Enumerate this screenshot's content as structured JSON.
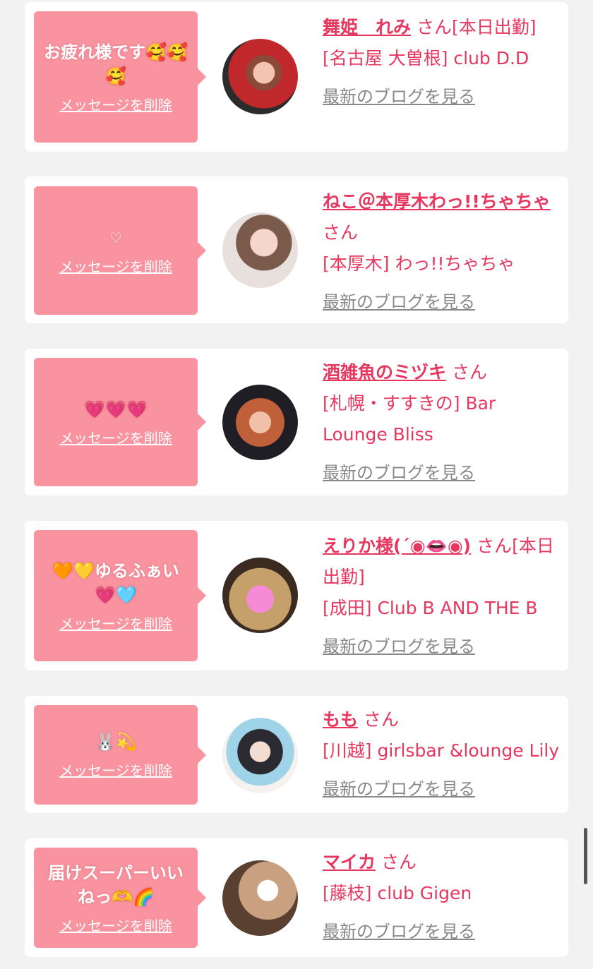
{
  "delete_label": "メッセージを削除",
  "blog_label": "最新のブログを見る",
  "san_suffix": "さん",
  "colors": {
    "bubble": "#f8939f",
    "accent": "#e8375f",
    "page_bg": "#f2f2f2"
  },
  "items": [
    {
      "message": "お疲れ様です🥰🥰🥰",
      "name": "舞姫　れみ",
      "status": "[本日出勤]",
      "shop": "[名古屋 大曽根] club D.D"
    },
    {
      "message": "♡",
      "name": "ねこ＠本厚木わっ!!ちゃちゃ",
      "status": "",
      "shop": "[本厚木] わっ!!ちゃちゃ"
    },
    {
      "message": "💗💗💗",
      "name": "酒雑魚のミヅキ",
      "status": "",
      "shop": "[札幌・すすきの] Bar Lounge Bliss"
    },
    {
      "message": "🧡💛ゆるふぁい💗🩵",
      "name": "えりか様(´◉👄◉)",
      "status": "[本日出勤]",
      "shop": "[成田] Club B AND THE B"
    },
    {
      "message": "🐰💫",
      "name": "もも",
      "status": "",
      "shop": "[川越] girlsbar &lounge Lily"
    },
    {
      "message": "届けスーパーいいねっ🫶🌈",
      "name": "マイカ",
      "status": "",
      "shop": "[藤枝] club Gigen"
    }
  ]
}
